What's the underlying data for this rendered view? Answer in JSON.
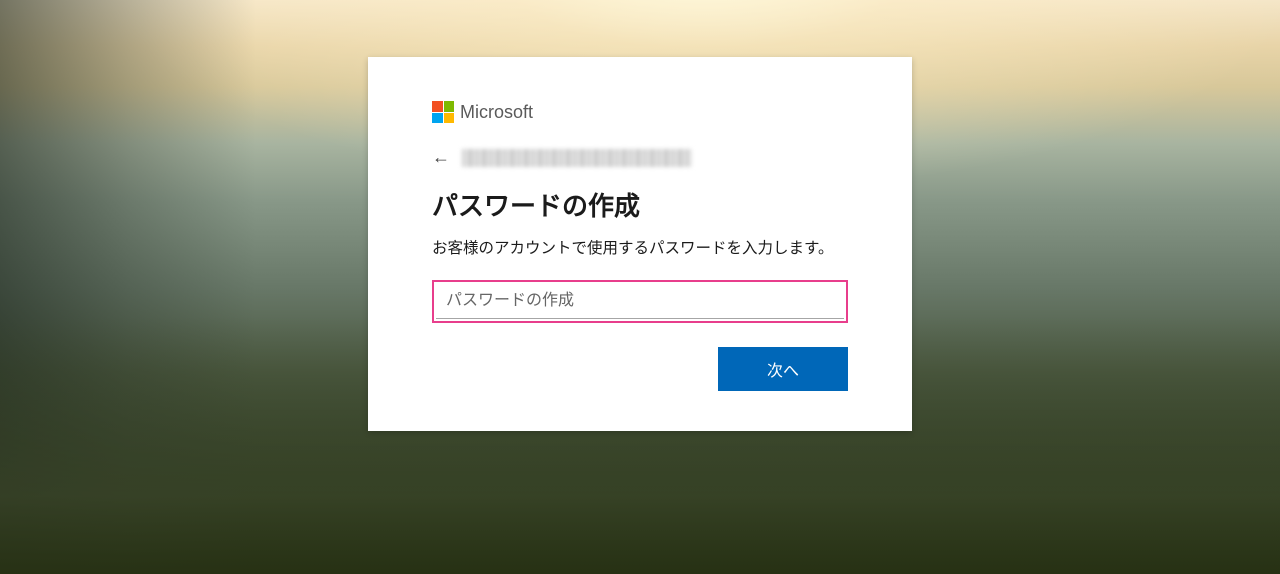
{
  "brand": {
    "name": "Microsoft",
    "logo_colors": {
      "top_left": "#f25022",
      "top_right": "#7fba00",
      "bottom_left": "#00a4ef",
      "bottom_right": "#ffb900"
    }
  },
  "form": {
    "heading": "パスワードの作成",
    "description": "お客様のアカウントで使用するパスワードを入力します。",
    "password_placeholder": "パスワードの作成",
    "password_value": "",
    "next_button_label": "次へ"
  },
  "highlight": {
    "border_color": "#e83e8c"
  },
  "colors": {
    "primary_button": "#0067b8"
  }
}
